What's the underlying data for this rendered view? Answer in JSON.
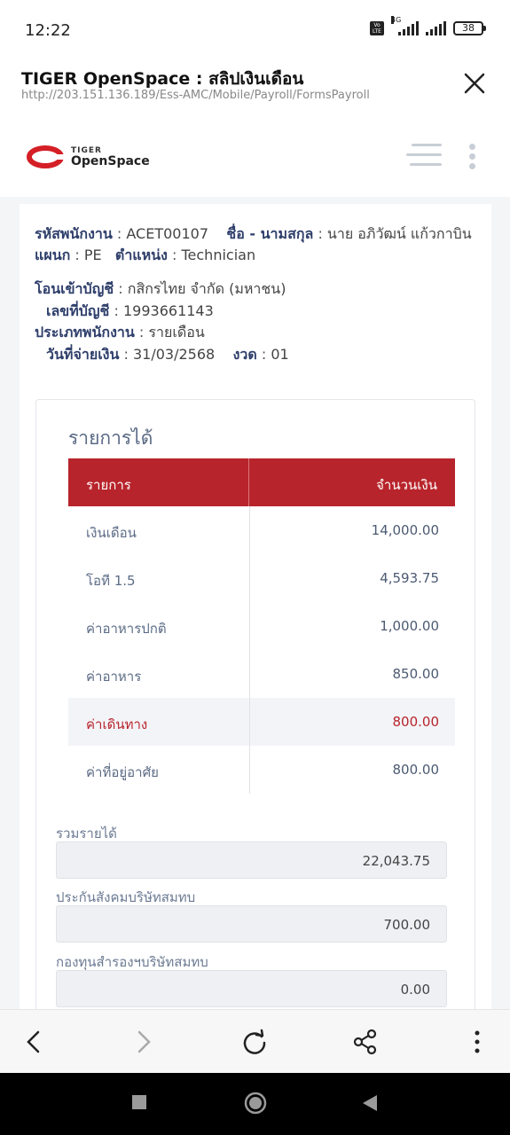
{
  "status": {
    "time": "12:22",
    "network": "4G",
    "volte": "Vo LTE",
    "battery": "38"
  },
  "browser": {
    "title": "TIGER OpenSpace : สลิปเงินเดือน",
    "url": "http://203.151.136.189/Ess-AMC/Mobile/Payroll/FormsPayroll"
  },
  "header": {
    "logo_line1": "TIGER",
    "logo_line2": "OpenSpace"
  },
  "employee": {
    "id_label": "รหัสพนักงาน",
    "id_value": "ACET00107",
    "name_label": "ชื่อ - นามสกุล",
    "name_value": "นาย อภิวัฒน์ แก้วกาบิน",
    "dept_label": "แผนก",
    "dept_value": "PE",
    "position_label": "ตำแหน่ง",
    "position_value": "Technician",
    "bank_label": "โอนเข้าบัญชี",
    "bank_value": "กสิกรไทย จำกัด (มหาชน)",
    "account_label": "เลขที่บัญชี",
    "account_value": "1993661143",
    "type_label": "ประเภทพนักงาน",
    "type_value": "รายเดือน",
    "paydate_label": "วันที่จ่ายเงิน",
    "paydate_value": "31/03/2568",
    "period_label": "งวด",
    "period_value": "01",
    "sep": ":"
  },
  "earnings": {
    "title": "รายการได้",
    "col_item": "รายการ",
    "col_amount": "จำนวนเงิน",
    "rows": [
      {
        "name": "เงินเดือน",
        "amount": "14,000.00"
      },
      {
        "name": "โอที 1.5",
        "amount": "4,593.75"
      },
      {
        "name": "ค่าอาหารปกติ",
        "amount": "1,000.00"
      },
      {
        "name": "ค่าอาหาร",
        "amount": "850.00"
      },
      {
        "name": "ค่าเดินทาง",
        "amount": "800.00"
      },
      {
        "name": "ค่าที่อยู่อาศัย",
        "amount": "800.00"
      }
    ]
  },
  "summary": {
    "total_label": "รวมรายได้",
    "total_value": "22,043.75",
    "social_label": "ประกันสังคมบริษัทสมทบ",
    "social_value": "700.00",
    "fund_label": "กองทุนสำรองฯบริษัทสมทบ",
    "fund_value": "0.00"
  },
  "colors": {
    "accent": "#b8242b",
    "label": "#2f3f6b"
  }
}
